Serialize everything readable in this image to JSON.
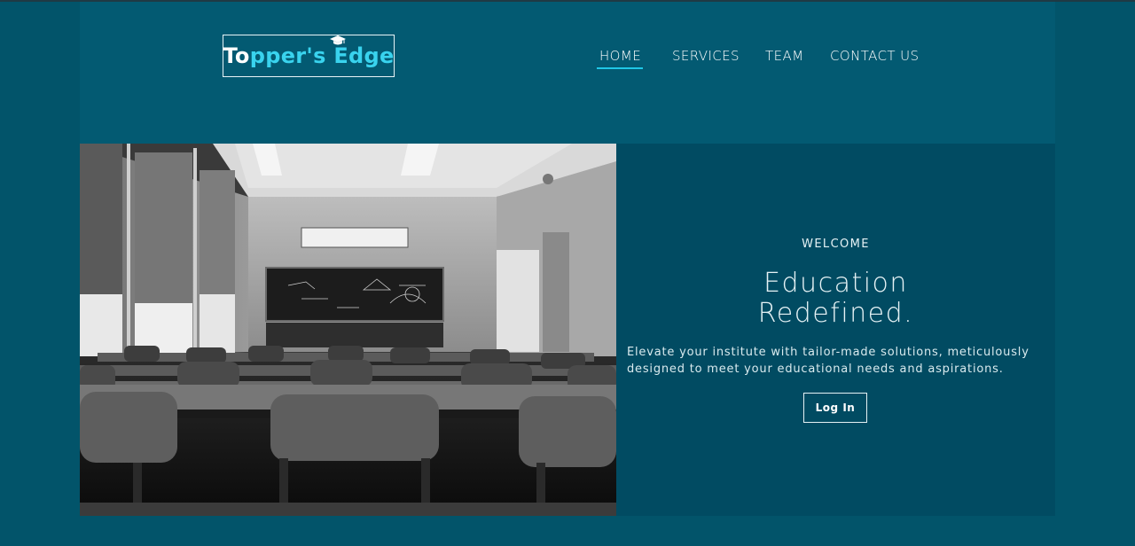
{
  "brand": {
    "logo_part1": "To",
    "logo_part2": "pp",
    "logo_part3": "er's ",
    "logo_part4": "Edge",
    "colors": {
      "primary": "#ffffff",
      "accent": "#39d3ee"
    },
    "icon": "graduation-cap-icon"
  },
  "nav": {
    "items": [
      {
        "label": "HOME",
        "active": true
      },
      {
        "label": "SERVICES",
        "active": false
      },
      {
        "label": "TEAM",
        "active": false
      },
      {
        "label": "CONTACT US",
        "active": false
      }
    ],
    "active_color": "#20c7e6"
  },
  "hero": {
    "image": "classroom-photo",
    "welcome": "WELCOME",
    "headline_line1": "Education",
    "headline_line2": "Redefined.",
    "description": "Elevate your institute with tailor-made solutions, meticulously designed to meet your educational needs and aspirations.",
    "cta_label": "Log In"
  },
  "colors": {
    "background": "#02546a",
    "panel": "#014b62"
  }
}
